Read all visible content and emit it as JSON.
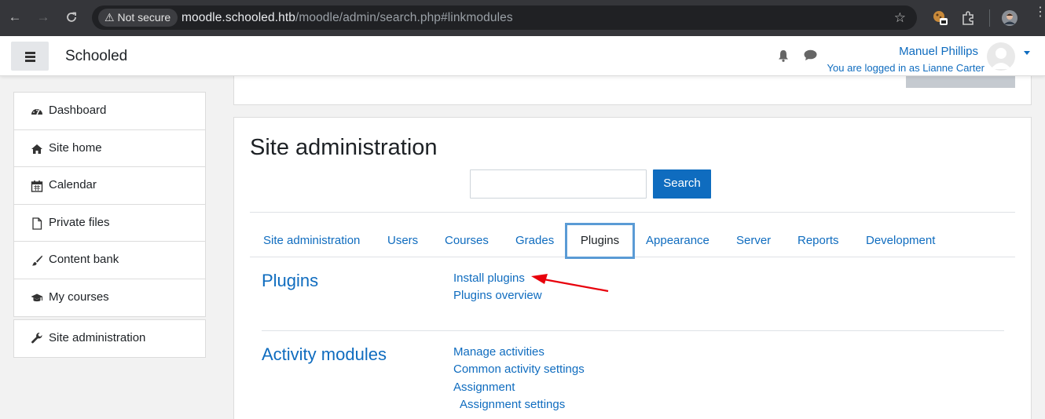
{
  "browser": {
    "security_label": "Not secure",
    "url_host": "moodle.schooled.htb",
    "url_path": "/moodle/admin/search.php#linkmodules"
  },
  "header": {
    "brand": "Schooled",
    "user_name": "Manuel Phillips",
    "logged_in_as": "You are logged in as Lianne Carter"
  },
  "sidebar": {
    "items": [
      {
        "label": "Dashboard",
        "icon": "dashboard-icon"
      },
      {
        "label": "Site home",
        "icon": "home-icon"
      },
      {
        "label": "Calendar",
        "icon": "calendar-icon"
      },
      {
        "label": "Private files",
        "icon": "file-icon"
      },
      {
        "label": "Content bank",
        "icon": "paintbrush-icon"
      },
      {
        "label": "My courses",
        "icon": "graduation-cap-icon"
      }
    ],
    "admin": {
      "label": "Site administration",
      "icon": "wrench-icon"
    }
  },
  "main": {
    "page_title": "Site administration",
    "search_button": "Search",
    "search_value": "",
    "tabs": [
      "Site administration",
      "Users",
      "Courses",
      "Grades",
      "Plugins",
      "Appearance",
      "Server",
      "Reports",
      "Development"
    ],
    "active_tab": "Plugins",
    "sections": [
      {
        "title": "Plugins",
        "links": [
          "Install plugins",
          "Plugins overview"
        ]
      },
      {
        "title": "Activity modules",
        "links": [
          "Manage activities",
          "Common activity settings",
          "Assignment",
          "Assignment settings"
        ]
      }
    ]
  },
  "colors": {
    "link": "#0f6cbf",
    "annotation_arrow": "#e8000b",
    "active_tab_border": "#5a9bd5"
  }
}
